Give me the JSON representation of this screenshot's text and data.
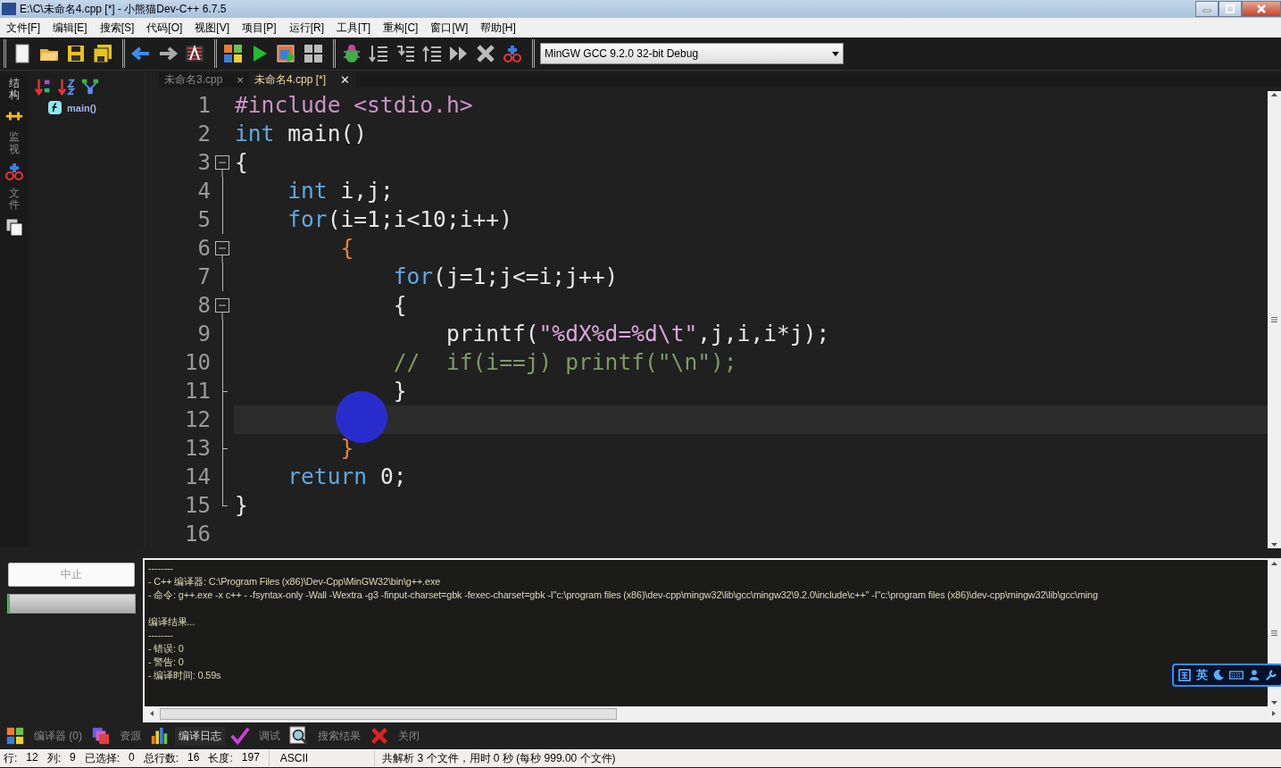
{
  "window": {
    "title": "E:\\C\\未命名4.cpp [*] - 小熊猫Dev-C++ 6.7.5"
  },
  "menu": [
    "文件[F]",
    "编辑[E]",
    "搜索[S]",
    "代码[O]",
    "视图[V]",
    "项目[P]",
    "运行[R]",
    "工具[T]",
    "重构[C]",
    "窗口[W]",
    "帮助[H]"
  ],
  "compiler_select": {
    "value": "MinGW GCC 9.2.0 32-bit Debug"
  },
  "side_tabs": [
    {
      "label": "结构",
      "selected": true
    },
    {
      "label": "监视",
      "selected": false
    },
    {
      "label": "文件",
      "selected": false
    }
  ],
  "structure": {
    "items": [
      {
        "label": "main()"
      }
    ]
  },
  "editor_tabs": [
    {
      "label": "未命名3.cpp",
      "close": "×",
      "selected": false
    },
    {
      "label": "未命名4.cpp [*]",
      "close": "✕",
      "selected": true
    }
  ],
  "code_lines": [
    {
      "number": "1",
      "kind": "plain",
      "current": false,
      "tokens": [
        {
          "kind": "preprocessor",
          "text": "#include <stdio.h>"
        }
      ]
    },
    {
      "number": "2",
      "kind": "plain",
      "current": false,
      "tokens": [
        {
          "kind": "keyword",
          "text": "int"
        },
        {
          "kind": "identifier",
          "text": " main()"
        }
      ]
    },
    {
      "number": "3",
      "kind": "fold-open",
      "current": false,
      "tokens": [
        {
          "kind": "identifier",
          "text": "{"
        }
      ]
    },
    {
      "number": "4",
      "kind": "fold-line",
      "current": false,
      "tokens": [
        {
          "kind": "keyword",
          "text": "    int"
        },
        {
          "kind": "identifier",
          "text": " i,j;"
        }
      ]
    },
    {
      "number": "5",
      "kind": "fold-line",
      "current": false,
      "tokens": [
        {
          "kind": "keyword",
          "text": "    for"
        },
        {
          "kind": "identifier",
          "text": "(i=1;i<10;i++)"
        }
      ]
    },
    {
      "number": "6",
      "kind": "fold-open",
      "current": false,
      "tokens": [
        {
          "kind": "brace",
          "text": "        {"
        }
      ]
    },
    {
      "number": "7",
      "kind": "fold-line",
      "current": false,
      "tokens": [
        {
          "kind": "keyword",
          "text": "            for"
        },
        {
          "kind": "identifier",
          "text": "(j=1;j<=i;j++)"
        }
      ]
    },
    {
      "number": "8",
      "kind": "fold-open",
      "current": false,
      "tokens": [
        {
          "kind": "identifier",
          "text": "            {"
        }
      ]
    },
    {
      "number": "9",
      "kind": "fold-line",
      "current": false,
      "tokens": [
        {
          "kind": "identifier",
          "text": "                printf("
        },
        {
          "kind": "string",
          "text": "\"%dX%d=%d\\t\""
        },
        {
          "kind": "identifier",
          "text": ",j,i,i*j);"
        }
      ]
    },
    {
      "number": "10",
      "kind": "fold-line",
      "current": false,
      "tokens": [
        {
          "kind": "comment",
          "text": "            //  if(i==j) printf(\"\\n\");"
        }
      ]
    },
    {
      "number": "11",
      "kind": "fold-tick",
      "current": false,
      "tokens": [
        {
          "kind": "identifier",
          "text": "            }"
        }
      ]
    },
    {
      "number": "12",
      "kind": "fold-line",
      "current": true
    },
    {
      "number": "13",
      "kind": "fold-tick",
      "current": false,
      "tokens": [
        {
          "kind": "brace",
          "text": "        }"
        }
      ]
    },
    {
      "number": "14",
      "kind": "fold-line",
      "current": false,
      "tokens": [
        {
          "kind": "keyword",
          "text": "    return"
        },
        {
          "kind": "identifier",
          "text": " 0;"
        }
      ]
    },
    {
      "number": "15",
      "kind": "fold-end",
      "current": false,
      "tokens": [
        {
          "kind": "identifier",
          "text": "}"
        }
      ]
    },
    {
      "number": "16",
      "kind": "plain",
      "current": false
    }
  ],
  "stop_button": {
    "label": "中止",
    "disabled": true
  },
  "progress": {
    "level": 0
  },
  "log_blocks": [
    {
      "lines": [
        "--------",
        "- C++ 编译器: C:\\Program Files (x86)\\Dev-Cpp\\MinGW32\\bin\\g++.exe",
        "- 命令: g++.exe -x c++ - -fsyntax-only -Wall -Wextra -g3 -finput-charset=gbk -fexec-charset=gbk -I\"c:\\program files (x86)\\dev-cpp\\mingw32\\lib\\gcc\\mingw32\\9.2.0\\include\\c++\" -I\"c:\\program files (x86)\\dev-cpp\\mingw32\\lib\\gcc\\ming"
      ]
    },
    {
      "lines": [
        "编译结果...",
        "--------",
        "- 错误: 0",
        "- 警告: 0",
        "- 编译时间: 0.59s"
      ]
    }
  ],
  "ime_bar": {
    "label": "英"
  },
  "bottom_tabs": [
    {
      "label": "编译器 (0)",
      "selected": false
    },
    {
      "label": "资源",
      "selected": false
    },
    {
      "label": "编译日志",
      "selected": true
    },
    {
      "label": "调试",
      "selected": false
    },
    {
      "label": "搜索结果",
      "selected": false
    },
    {
      "label": "关闭",
      "selected": false
    }
  ],
  "status_bar": {
    "fields": [
      {
        "label": "行:",
        "value": "12"
      },
      {
        "label": "列:",
        "value": "9"
      },
      {
        "label": "已选择:",
        "value": "0"
      },
      {
        "label": "总行数:",
        "value": "16"
      },
      {
        "label": "长度:",
        "value": "197"
      }
    ],
    "encoding": "ASCII",
    "message": "共解析 3 个文件，用时 0 秒 (每秒 999.00 个文件)"
  }
}
